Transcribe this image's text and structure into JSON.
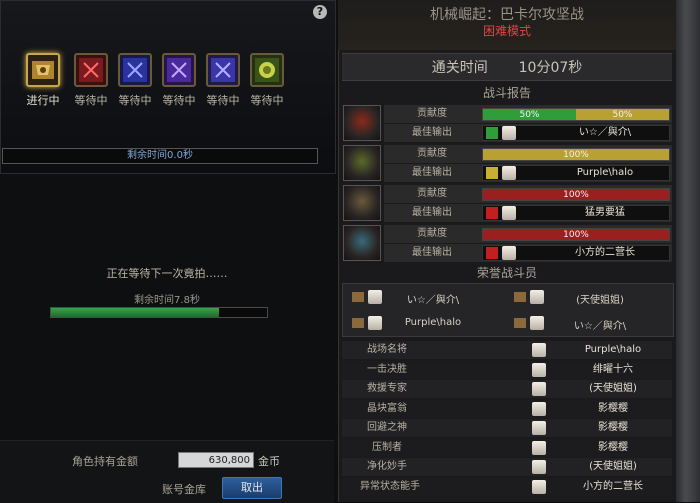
{
  "left": {
    "help_icon": "?",
    "stages": [
      {
        "label": "进行中",
        "icon": "helmet-icon",
        "color": "#c8962e"
      },
      {
        "label": "等待中",
        "icon": "card-red-icon",
        "color": "#b53434"
      },
      {
        "label": "等待中",
        "icon": "card-blue-icon",
        "color": "#4a5bd4"
      },
      {
        "label": "等待中",
        "icon": "card-purple-icon",
        "color": "#6a4ac4"
      },
      {
        "label": "等待中",
        "icon": "card-violet-icon",
        "color": "#5a50c8"
      },
      {
        "label": "等待中",
        "icon": "coin-icon",
        "color": "#8faa3c"
      }
    ],
    "remaining_time": "剩余时间0.0秒",
    "waiting_text": "正在等待下一次竟拍……",
    "waiting_time": "剩余时间7.8秒",
    "waiting_progress": 0.78,
    "gold_label": "角色持有金额",
    "gold_value": "630,800",
    "gold_unit": "金币",
    "account_label": "账号金库",
    "take_out_button": "取出"
  },
  "right": {
    "dungeon_title": "机械崛起：巴卡尔攻坚战",
    "difficulty": "困难模式",
    "clear_time_label": "通关时间",
    "clear_time_value": "10分07秒",
    "battle_report_title": "战斗报告",
    "contribution_label": "贡献度",
    "best_output_label": "最佳输出",
    "report_rows": [
      {
        "class_icon": "red-crest-icon",
        "segments": [
          {
            "pct": "50%",
            "value": 0.5,
            "color": "#2f9e3a"
          },
          {
            "pct": "50%",
            "value": 0.5,
            "color": "#b8a032"
          }
        ],
        "best": "い☆／與介\\",
        "rank_icon": "green-slash-icon"
      },
      {
        "class_icon": "green-crest-icon",
        "segments": [
          {
            "pct": "100%",
            "value": 1.0,
            "color": "#b8a032"
          }
        ],
        "best": "Purple\\halo",
        "rank_icon": "yellow-slash-icon"
      },
      {
        "class_icon": "bronze-crest-icon",
        "segments": [
          {
            "pct": "100%",
            "value": 1.0,
            "color": "#9a1f1f"
          }
        ],
        "best": "猛男要猛",
        "rank_icon": "red-3-icon"
      },
      {
        "class_icon": "teal-crest-icon",
        "segments": [
          {
            "pct": "100%",
            "value": 1.0,
            "color": "#9a1f1f"
          }
        ],
        "best": "小方的二营长",
        "rank_icon": "red-4-icon"
      }
    ],
    "honor_title": "荣誉战斗员",
    "honor_members": [
      {
        "name": "い☆／與介\\"
      },
      {
        "name": "(天使姐姐)"
      },
      {
        "name": "Purple\\halo"
      },
      {
        "name": "い☆／與介\\"
      }
    ],
    "awards": [
      {
        "title": "战场名将",
        "name": "Purple\\halo"
      },
      {
        "title": "一击决胜",
        "name": "绯曜十六"
      },
      {
        "title": "救援专家",
        "name": "(天使姐姐)"
      },
      {
        "title": "晶块富翁",
        "name": "影樱樱"
      },
      {
        "title": "回避之神",
        "name": "影樱樱"
      },
      {
        "title": "压制者",
        "name": "影樱樱"
      },
      {
        "title": "净化妙手",
        "name": "(天使姐姐)"
      },
      {
        "title": "异常状态能手",
        "name": "小方的二营长"
      }
    ]
  }
}
